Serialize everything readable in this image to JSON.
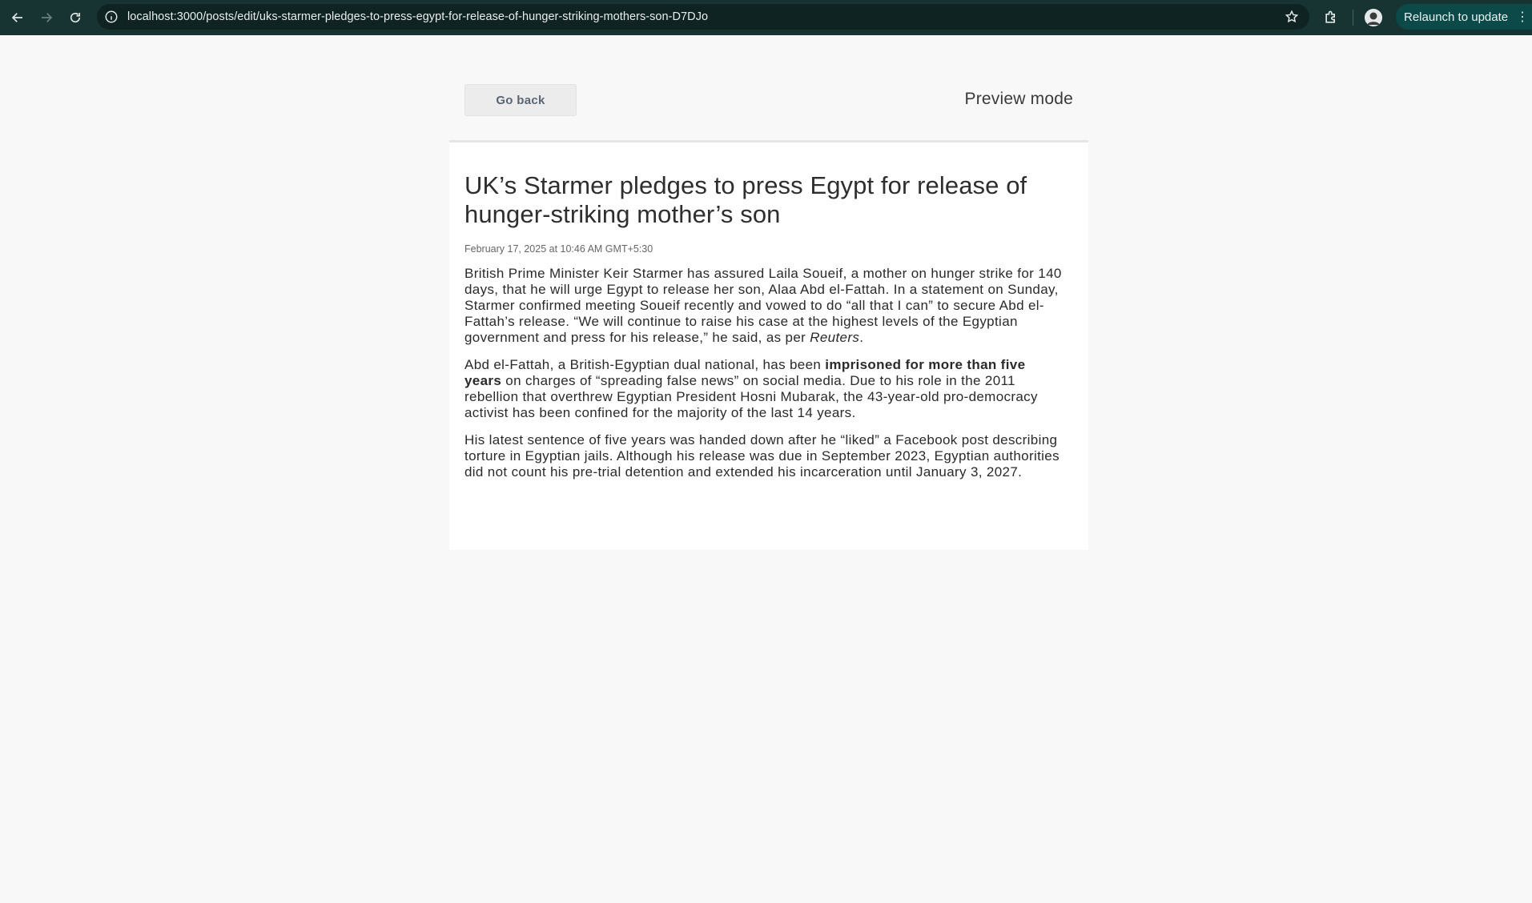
{
  "browser": {
    "url": "localhost:3000/posts/edit/uks-starmer-pledges-to-press-egypt-for-release-of-hunger-striking-mothers-son-D7DJo",
    "relaunch_label": "Relaunch to update"
  },
  "page": {
    "go_back_label": "Go back",
    "preview_mode_label": "Preview mode"
  },
  "article": {
    "title": "UK’s Starmer pledges to press Egypt for release of hunger-striking mother’s son",
    "date": "February 17, 2025 at 10:46 AM GMT+5:30",
    "p1_text": "British Prime Minister Keir Starmer has assured Laila Soueif, a mother on hunger strike for 140 days, that he will urge Egypt to release her son, Alaa Abd el-Fattah. In a statement on Sunday, Starmer confirmed meeting Soueif recently and vowed to do “all that I can” to secure Abd el-Fattah’s release. “We will continue to raise his case at the highest levels of the Egyptian government and press for his release,” he said, as per ",
    "p1_italic": "Reuters",
    "p1_end": ".",
    "p2_start": "Abd el-Fattah, a British-Egyptian dual national, has been ",
    "p2_bold": "imprisoned for more than five years",
    "p2_end": " on charges of “spreading false news” on social media. Due to his role in the 2011 rebellion that overthrew Egyptian President Hosni Mubarak, the 43-year-old pro-democracy activist has been confined for the majority of the last 14 years.",
    "p3_text": "His latest sentence of five years was handed down after he “liked” a Facebook post describing torture in Egyptian jails. Although his release was due in September 2023, Egyptian authorities did not count his pre-trial detention and extended his incarceration until January 3, 2027."
  },
  "icons": {
    "back": "arrow-left-icon",
    "forward": "arrow-right-icon",
    "reload": "reload-icon",
    "site_info": "info-icon",
    "bookmark": "star-icon",
    "extensions": "puzzle-icon",
    "profile": "avatar-icon",
    "menu": "kebab-icon"
  }
}
